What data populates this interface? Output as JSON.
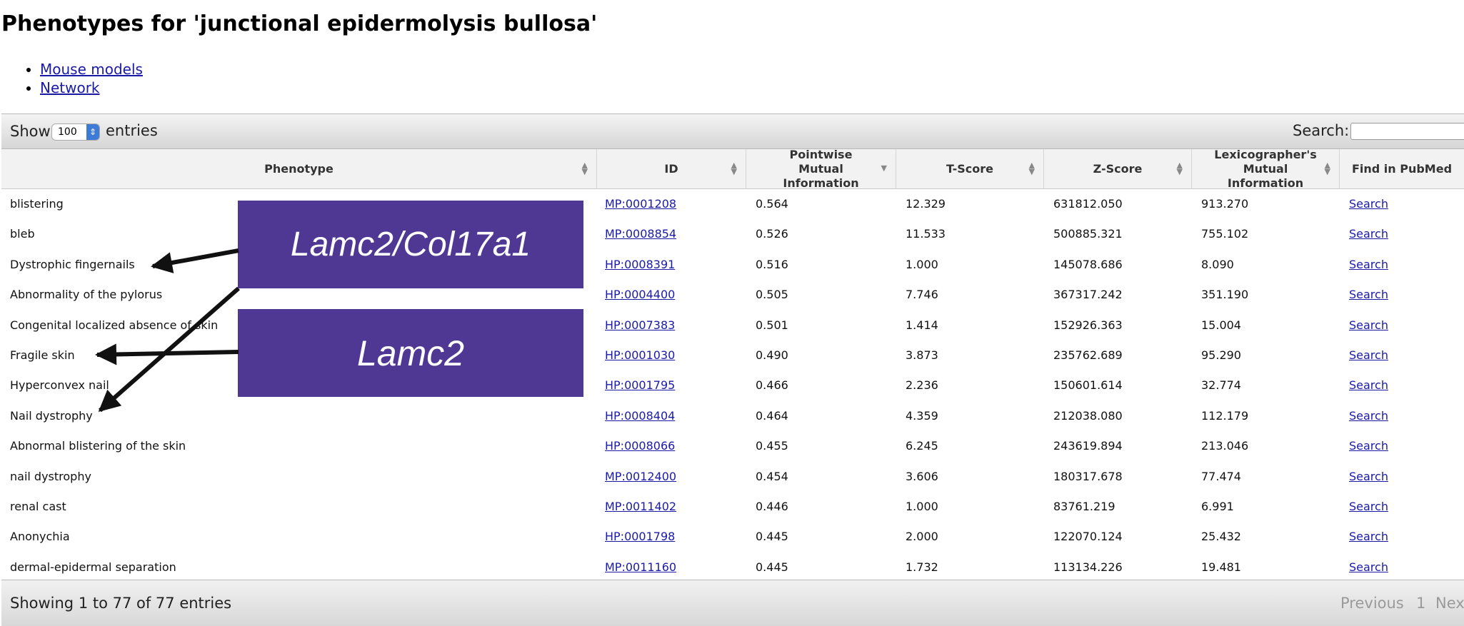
{
  "page": {
    "title": "Phenotypes for 'junctional epidermolysis bullosa'",
    "nav_links": [
      "Mouse models",
      "Network"
    ]
  },
  "controls": {
    "show_label": "Show",
    "entries_value": "100",
    "entries_label": "entries",
    "search_label": "Search:",
    "search_value": ""
  },
  "table": {
    "columns": [
      "Phenotype",
      "ID",
      "Pointwise Mutual Information",
      "T-Score",
      "Z-Score",
      "Lexicographer's Mutual Information",
      "Find in PubMed"
    ],
    "rows": [
      {
        "phenotype": "blistering",
        "id": "MP:0001208",
        "pmi": "0.564",
        "tscore": "12.329",
        "zscore": "631812.050",
        "lmi": "913.270",
        "pubmed": "Search"
      },
      {
        "phenotype": "bleb",
        "id": "MP:0008854",
        "pmi": "0.526",
        "tscore": "11.533",
        "zscore": "500885.321",
        "lmi": "755.102",
        "pubmed": "Search"
      },
      {
        "phenotype": "Dystrophic fingernails",
        "id": "HP:0008391",
        "pmi": "0.516",
        "tscore": "1.000",
        "zscore": "145078.686",
        "lmi": "8.090",
        "pubmed": "Search"
      },
      {
        "phenotype": "Abnormality of the pylorus",
        "id": "HP:0004400",
        "pmi": "0.505",
        "tscore": "7.746",
        "zscore": "367317.242",
        "lmi": "351.190",
        "pubmed": "Search"
      },
      {
        "phenotype": "Congenital localized absence of skin",
        "id": "HP:0007383",
        "pmi": "0.501",
        "tscore": "1.414",
        "zscore": "152926.363",
        "lmi": "15.004",
        "pubmed": "Search"
      },
      {
        "phenotype": "Fragile skin",
        "id": "HP:0001030",
        "pmi": "0.490",
        "tscore": "3.873",
        "zscore": "235762.689",
        "lmi": "95.290",
        "pubmed": "Search"
      },
      {
        "phenotype": "Hyperconvex nail",
        "id": "HP:0001795",
        "pmi": "0.466",
        "tscore": "2.236",
        "zscore": "150601.614",
        "lmi": "32.774",
        "pubmed": "Search"
      },
      {
        "phenotype": "Nail dystrophy",
        "id": "HP:0008404",
        "pmi": "0.464",
        "tscore": "4.359",
        "zscore": "212038.080",
        "lmi": "112.179",
        "pubmed": "Search"
      },
      {
        "phenotype": "Abnormal blistering of the skin",
        "id": "HP:0008066",
        "pmi": "0.455",
        "tscore": "6.245",
        "zscore": "243619.894",
        "lmi": "213.046",
        "pubmed": "Search"
      },
      {
        "phenotype": "nail dystrophy",
        "id": "MP:0012400",
        "pmi": "0.454",
        "tscore": "3.606",
        "zscore": "180317.678",
        "lmi": "77.474",
        "pubmed": "Search"
      },
      {
        "phenotype": "renal cast",
        "id": "MP:0011402",
        "pmi": "0.446",
        "tscore": "1.000",
        "zscore": "83761.219",
        "lmi": "6.991",
        "pubmed": "Search"
      },
      {
        "phenotype": "Anonychia",
        "id": "HP:0001798",
        "pmi": "0.445",
        "tscore": "2.000",
        "zscore": "122070.124",
        "lmi": "25.432",
        "pubmed": "Search"
      },
      {
        "phenotype": "dermal-epidermal separation",
        "id": "MP:0011160",
        "pmi": "0.445",
        "tscore": "1.732",
        "zscore": "113134.226",
        "lmi": "19.481",
        "pubmed": "Search"
      }
    ]
  },
  "footer": {
    "info": "Showing 1 to 77 of 77 entries",
    "previous": "Previous",
    "page": "1",
    "next": "Next"
  },
  "annotations": {
    "callout_1": "Lamc2/Col17a1",
    "callout_2": "Lamc2",
    "callout_color": "#4f3794"
  }
}
